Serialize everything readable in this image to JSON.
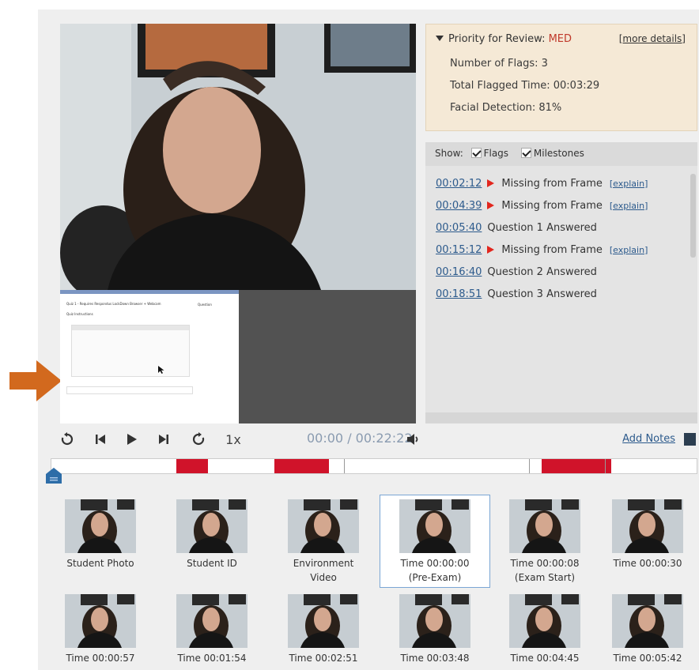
{
  "priority": {
    "label": "Priority for Review: ",
    "value": "MED",
    "more_details": "[more details]",
    "flags_count": "Number of Flags: 3",
    "flagged_time": "Total Flagged Time:  00:03:29",
    "facial_detection": "Facial Detection: 81%"
  },
  "show_bar": {
    "label": "Show:",
    "flags_label": "Flags",
    "milestones_label": "Milestones"
  },
  "events": [
    {
      "time": "00:02:12",
      "flag": true,
      "text": "Missing from Frame",
      "explain": "[explain]"
    },
    {
      "time": "00:04:39",
      "flag": true,
      "text": "Missing from Frame",
      "explain": "[explain]"
    },
    {
      "time": "00:05:40",
      "flag": false,
      "text": "Question 1 Answered",
      "explain": ""
    },
    {
      "time": "00:15:12",
      "flag": true,
      "text": "Missing from Frame",
      "explain": "[explain]"
    },
    {
      "time": "00:16:40",
      "flag": false,
      "text": "Question 2 Answered",
      "explain": ""
    },
    {
      "time": "00:18:51",
      "flag": false,
      "text": "Question 3 Answered",
      "explain": ""
    }
  ],
  "controls": {
    "speed": "1x",
    "time": "00:00 / 00:22:22",
    "add_notes": "Add Notes"
  },
  "screen_recording": {
    "title": "Quiz 1 - Requires Respondus LockDown Browser + Webcam",
    "subtitle": "Quiz Instructions",
    "side_heading": "Question"
  },
  "timeline": {
    "flag_segments": [
      {
        "start": 0.194,
        "end": 0.243
      },
      {
        "start": 0.345,
        "end": 0.43
      },
      {
        "start": 0.76,
        "end": 0.868
      }
    ],
    "markers": [
      0.453,
      0.74,
      0.858
    ]
  },
  "thumbnails_row1": [
    {
      "label": "Student Photo",
      "label2": ""
    },
    {
      "label": "Student ID",
      "label2": ""
    },
    {
      "label": "Environment",
      "label2": "Video"
    },
    {
      "label": "Time 00:00:00",
      "label2": "(Pre-Exam)"
    },
    {
      "label": "Time 00:00:08",
      "label2": "(Exam Start)"
    },
    {
      "label": "Time 00:00:30",
      "label2": ""
    }
  ],
  "thumbnails_row2": [
    {
      "label": "Time 00:00:57"
    },
    {
      "label": "Time 00:01:54"
    },
    {
      "label": "Time 00:02:51"
    },
    {
      "label": "Time 00:03:48"
    },
    {
      "label": "Time 00:04:45"
    },
    {
      "label": "Time 00:05:42"
    }
  ],
  "colors": {
    "flag_red": "#d0132a",
    "link_blue": "#2c5a8c",
    "priority_bg": "#f5e9d6",
    "arrow_orange": "#d2691e"
  },
  "icons": [
    "rewind-icon",
    "skip-back-icon",
    "play-icon",
    "skip-forward-icon",
    "fast-forward-icon",
    "volume-icon",
    "notes-icon",
    "playhead-icon",
    "pointer-arrow-icon"
  ]
}
